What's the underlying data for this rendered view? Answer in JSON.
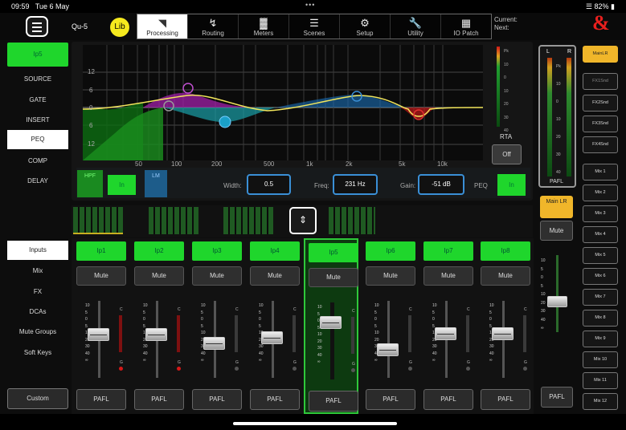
{
  "status": {
    "time": "09:59",
    "date": "Tue 6 May",
    "dots": "•••",
    "battery": "82%"
  },
  "header": {
    "device": "Qu-5",
    "lib": "Lib",
    "current_label": "Current:",
    "next_label": "Next:",
    "brand": "&"
  },
  "tabs": [
    {
      "label": "Processing",
      "icon": "processing-icon"
    },
    {
      "label": "Routing",
      "icon": "routing-icon"
    },
    {
      "label": "Meters",
      "icon": "meters-icon"
    },
    {
      "label": "Scenes",
      "icon": "scenes-icon"
    },
    {
      "label": "Setup",
      "icon": "setup-icon"
    },
    {
      "label": "Utility",
      "icon": "wrench-icon"
    },
    {
      "label": "IO Patch",
      "icon": "io-patch-icon"
    }
  ],
  "leftnav": {
    "channel": "Ip5",
    "items": [
      "SOURCE",
      "GATE",
      "INSERT",
      "PEQ",
      "COMP",
      "DELAY"
    ],
    "selected": "PEQ"
  },
  "layers": {
    "items": [
      "Inputs",
      "Mix",
      "FX",
      "DCAs",
      "Mute Groups",
      "Soft Keys"
    ],
    "selected": "Inputs",
    "custom": "Custom"
  },
  "eq": {
    "db_labels": [
      "12",
      "6",
      "0",
      "6",
      "12"
    ],
    "freq_labels": [
      "50",
      "100",
      "200",
      "500",
      "1k",
      "2k",
      "5k",
      "10k"
    ],
    "rta_labels": [
      "Pk",
      "10",
      "0",
      "10",
      "20",
      "30",
      "40"
    ],
    "rta": "RTA",
    "rta_btn": "Off"
  },
  "controls": {
    "hpf": "HPF",
    "hpf_in": "In",
    "lm": "LM",
    "width_label": "Width:",
    "width": "0.5",
    "freq_label": "Freq:",
    "freq": "231 Hz",
    "gain_label": "Gain:",
    "gain": "-51 dB",
    "peq_label": "PEQ",
    "peq_in": "In"
  },
  "channels": [
    {
      "name": "Ip1",
      "mute": "Mute",
      "pafl": "PAFL"
    },
    {
      "name": "Ip2",
      "mute": "Mute",
      "pafl": "PAFL"
    },
    {
      "name": "Ip3",
      "mute": "Mute",
      "pafl": "PAFL"
    },
    {
      "name": "Ip4",
      "mute": "Mute",
      "pafl": "PAFL"
    },
    {
      "name": "Ip5",
      "mute": "Mute",
      "pafl": "PAFL"
    },
    {
      "name": "Ip6",
      "mute": "Mute",
      "pafl": "PAFL"
    },
    {
      "name": "Ip7",
      "mute": "Mute",
      "pafl": "PAFL"
    },
    {
      "name": "Ip8",
      "mute": "Mute",
      "pafl": "PAFL"
    }
  ],
  "fader_scale": [
    "10",
    "5",
    "0",
    "5",
    "10",
    "20",
    "30",
    "40",
    "∞"
  ],
  "master": {
    "l": "L",
    "r": "R",
    "pafl": "PAFL",
    "main_lr": "Main LR",
    "mute": "Mute",
    "master_pafl": "PAFL",
    "meter_labels": [
      "Pk",
      "10",
      "0",
      "10",
      "20",
      "30",
      "40"
    ]
  },
  "mixes": [
    "MainLR",
    "FX1Snd",
    "FX2Snd",
    "FX3Snd",
    "FX4Snd",
    "Mix 1",
    "Mix 2",
    "Mix 3",
    "Mix 4",
    "Mix 5",
    "Mix 6",
    "Mix 7",
    "Mix 8",
    "Mix 9",
    "Mix 10",
    "Mix 11",
    "Mix 12"
  ],
  "colors": {
    "accent": "#1fd62c",
    "selected_mix": "#f0b62a",
    "brand": "#e8201e",
    "value_border": "#3a8fd6"
  }
}
